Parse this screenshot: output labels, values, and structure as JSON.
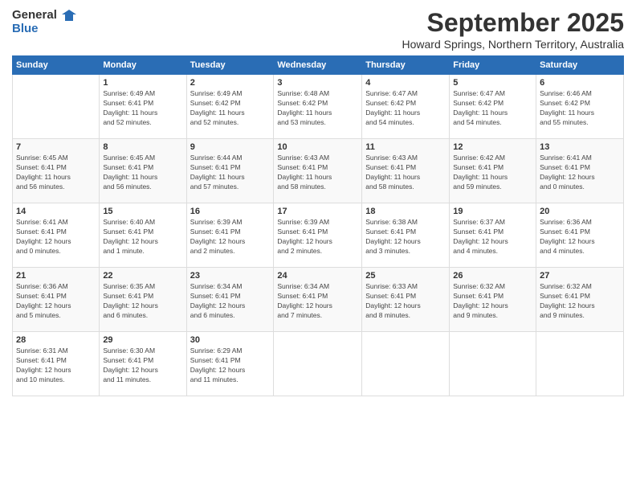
{
  "logo": {
    "line1": "General",
    "line2": "Blue"
  },
  "title": "September 2025",
  "location": "Howard Springs, Northern Territory, Australia",
  "weekdays": [
    "Sunday",
    "Monday",
    "Tuesday",
    "Wednesday",
    "Thursday",
    "Friday",
    "Saturday"
  ],
  "weeks": [
    [
      {
        "day": "",
        "info": ""
      },
      {
        "day": "1",
        "info": "Sunrise: 6:49 AM\nSunset: 6:41 PM\nDaylight: 11 hours\nand 52 minutes."
      },
      {
        "day": "2",
        "info": "Sunrise: 6:49 AM\nSunset: 6:42 PM\nDaylight: 11 hours\nand 52 minutes."
      },
      {
        "day": "3",
        "info": "Sunrise: 6:48 AM\nSunset: 6:42 PM\nDaylight: 11 hours\nand 53 minutes."
      },
      {
        "day": "4",
        "info": "Sunrise: 6:47 AM\nSunset: 6:42 PM\nDaylight: 11 hours\nand 54 minutes."
      },
      {
        "day": "5",
        "info": "Sunrise: 6:47 AM\nSunset: 6:42 PM\nDaylight: 11 hours\nand 54 minutes."
      },
      {
        "day": "6",
        "info": "Sunrise: 6:46 AM\nSunset: 6:42 PM\nDaylight: 11 hours\nand 55 minutes."
      }
    ],
    [
      {
        "day": "7",
        "info": "Sunrise: 6:45 AM\nSunset: 6:41 PM\nDaylight: 11 hours\nand 56 minutes."
      },
      {
        "day": "8",
        "info": "Sunrise: 6:45 AM\nSunset: 6:41 PM\nDaylight: 11 hours\nand 56 minutes."
      },
      {
        "day": "9",
        "info": "Sunrise: 6:44 AM\nSunset: 6:41 PM\nDaylight: 11 hours\nand 57 minutes."
      },
      {
        "day": "10",
        "info": "Sunrise: 6:43 AM\nSunset: 6:41 PM\nDaylight: 11 hours\nand 58 minutes."
      },
      {
        "day": "11",
        "info": "Sunrise: 6:43 AM\nSunset: 6:41 PM\nDaylight: 11 hours\nand 58 minutes."
      },
      {
        "day": "12",
        "info": "Sunrise: 6:42 AM\nSunset: 6:41 PM\nDaylight: 11 hours\nand 59 minutes."
      },
      {
        "day": "13",
        "info": "Sunrise: 6:41 AM\nSunset: 6:41 PM\nDaylight: 12 hours\nand 0 minutes."
      }
    ],
    [
      {
        "day": "14",
        "info": "Sunrise: 6:41 AM\nSunset: 6:41 PM\nDaylight: 12 hours\nand 0 minutes."
      },
      {
        "day": "15",
        "info": "Sunrise: 6:40 AM\nSunset: 6:41 PM\nDaylight: 12 hours\nand 1 minute."
      },
      {
        "day": "16",
        "info": "Sunrise: 6:39 AM\nSunset: 6:41 PM\nDaylight: 12 hours\nand 2 minutes."
      },
      {
        "day": "17",
        "info": "Sunrise: 6:39 AM\nSunset: 6:41 PM\nDaylight: 12 hours\nand 2 minutes."
      },
      {
        "day": "18",
        "info": "Sunrise: 6:38 AM\nSunset: 6:41 PM\nDaylight: 12 hours\nand 3 minutes."
      },
      {
        "day": "19",
        "info": "Sunrise: 6:37 AM\nSunset: 6:41 PM\nDaylight: 12 hours\nand 4 minutes."
      },
      {
        "day": "20",
        "info": "Sunrise: 6:36 AM\nSunset: 6:41 PM\nDaylight: 12 hours\nand 4 minutes."
      }
    ],
    [
      {
        "day": "21",
        "info": "Sunrise: 6:36 AM\nSunset: 6:41 PM\nDaylight: 12 hours\nand 5 minutes."
      },
      {
        "day": "22",
        "info": "Sunrise: 6:35 AM\nSunset: 6:41 PM\nDaylight: 12 hours\nand 6 minutes."
      },
      {
        "day": "23",
        "info": "Sunrise: 6:34 AM\nSunset: 6:41 PM\nDaylight: 12 hours\nand 6 minutes."
      },
      {
        "day": "24",
        "info": "Sunrise: 6:34 AM\nSunset: 6:41 PM\nDaylight: 12 hours\nand 7 minutes."
      },
      {
        "day": "25",
        "info": "Sunrise: 6:33 AM\nSunset: 6:41 PM\nDaylight: 12 hours\nand 8 minutes."
      },
      {
        "day": "26",
        "info": "Sunrise: 6:32 AM\nSunset: 6:41 PM\nDaylight: 12 hours\nand 9 minutes."
      },
      {
        "day": "27",
        "info": "Sunrise: 6:32 AM\nSunset: 6:41 PM\nDaylight: 12 hours\nand 9 minutes."
      }
    ],
    [
      {
        "day": "28",
        "info": "Sunrise: 6:31 AM\nSunset: 6:41 PM\nDaylight: 12 hours\nand 10 minutes."
      },
      {
        "day": "29",
        "info": "Sunrise: 6:30 AM\nSunset: 6:41 PM\nDaylight: 12 hours\nand 11 minutes."
      },
      {
        "day": "30",
        "info": "Sunrise: 6:29 AM\nSunset: 6:41 PM\nDaylight: 12 hours\nand 11 minutes."
      },
      {
        "day": "",
        "info": ""
      },
      {
        "day": "",
        "info": ""
      },
      {
        "day": "",
        "info": ""
      },
      {
        "day": "",
        "info": ""
      }
    ]
  ]
}
